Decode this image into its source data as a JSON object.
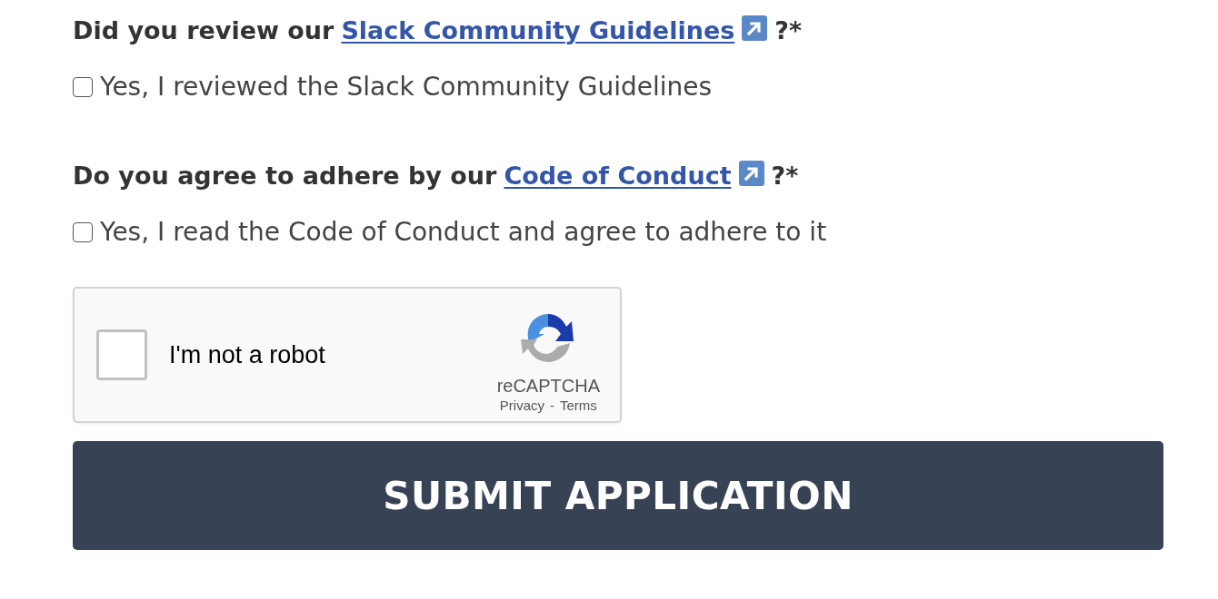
{
  "questions": [
    {
      "prompt": "Did you review our",
      "link": "Slack Community Guidelines",
      "suffix": "?*",
      "checkbox": {
        "label": "Yes, I reviewed the Slack Community Guidelines",
        "checked": false
      }
    },
    {
      "prompt": "Do you agree to adhere by our",
      "link": "Code of Conduct",
      "suffix": "?*",
      "checkbox": {
        "label": "Yes, I read the Code of Conduct and agree to adhere to it",
        "checked": false
      }
    }
  ],
  "captcha": {
    "label": "I'm not a robot",
    "checked": false,
    "brand": "reCAPTCHA",
    "privacy": "Privacy",
    "separator": "-",
    "terms": "Terms"
  },
  "submit_button": {
    "label": "SUBMIT APPLICATION"
  }
}
